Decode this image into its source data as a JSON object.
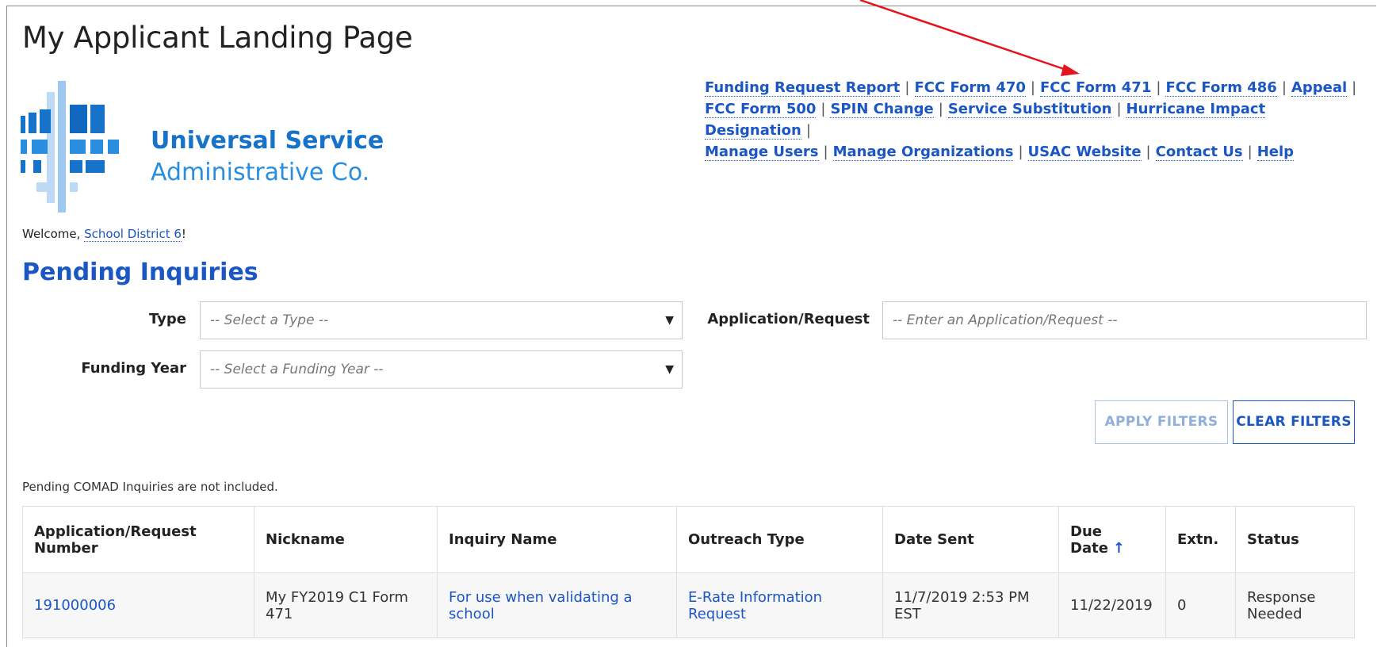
{
  "header": {
    "title": "My Applicant Landing Page"
  },
  "logo": {
    "line1": "Universal Service",
    "line2": "Administrative Co.",
    "colors": {
      "primary": "#1673c9",
      "secondary": "#2a8ee0",
      "light": "#9dc8ef"
    }
  },
  "top_links": [
    "Funding Request Report",
    "FCC Form 470",
    "FCC Form 471",
    "FCC Form 486",
    "Appeal",
    "FCC Form 500",
    "SPIN Change",
    "Service Substitution",
    "Hurricane Impact Designation",
    "Manage Users",
    "Manage Organizations",
    "USAC Website",
    "Contact Us",
    "Help"
  ],
  "welcome": {
    "prefix": "Welcome, ",
    "user": "School District 6",
    "suffix": "!"
  },
  "pending": {
    "title": "Pending Inquiries",
    "filters": {
      "type_label": "Type",
      "type_placeholder": "-- Select a Type --",
      "app_label": "Application/Request",
      "app_placeholder": "-- Enter an Application/Request --",
      "year_label": "Funding Year",
      "year_placeholder": "-- Select a Funding Year --"
    },
    "apply_label": "APPLY FILTERS",
    "clear_label": "CLEAR FILTERS",
    "note": "Pending COMAD Inquiries are not included."
  },
  "table": {
    "headers": [
      "Application/Request Number",
      "Nickname",
      "Inquiry Name",
      "Outreach Type",
      "Date Sent",
      "Due Date",
      "Extn.",
      "Status"
    ],
    "sort_indicator": "↑",
    "rows": [
      [
        "191000006",
        "My FY2019 C1 Form 471",
        "For use when validating a school",
        "E-Rate Information Request",
        "11/7/2019 2:53 PM EST",
        "11/22/2019",
        "0",
        "Response Needed"
      ]
    ]
  },
  "annotation": {
    "arrow_color": "#e3141b"
  }
}
